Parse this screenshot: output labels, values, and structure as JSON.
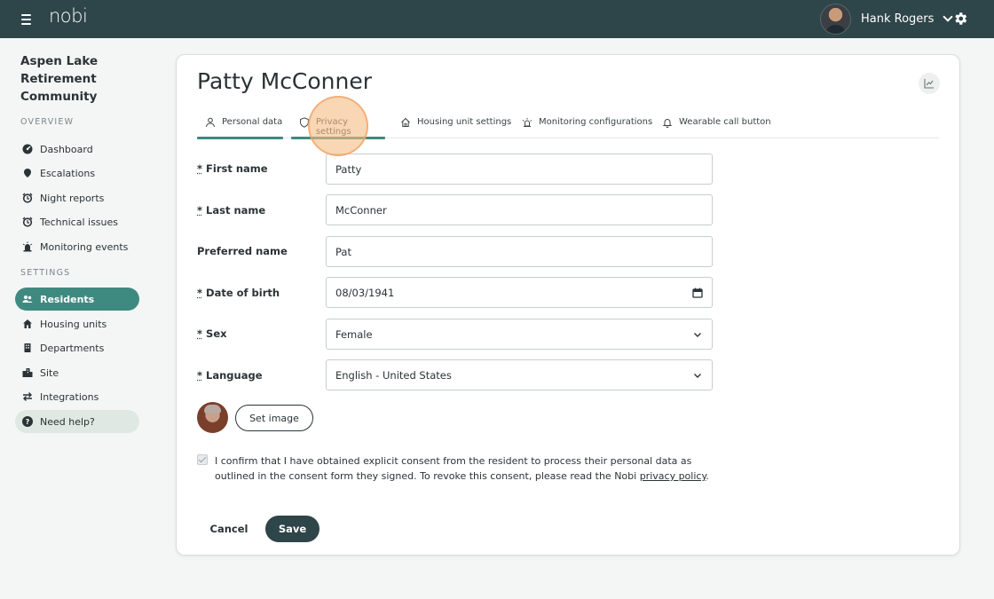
{
  "header": {
    "logo": "nobi",
    "user_name": "Hank Rogers"
  },
  "sidebar": {
    "community_name": "Aspen Lake Retirement Community",
    "overview_label": "OVERVIEW",
    "overview_items": [
      {
        "label": "Dashboard",
        "icon": "dashboard-icon"
      },
      {
        "label": "Escalations",
        "icon": "escalation-icon"
      },
      {
        "label": "Night reports",
        "icon": "alarm-clock-icon"
      },
      {
        "label": "Technical issues",
        "icon": "alarm-clock-icon"
      },
      {
        "label": "Monitoring events",
        "icon": "siren-icon"
      }
    ],
    "settings_label": "SETTINGS",
    "settings_items": [
      {
        "label": "Residents",
        "icon": "users-icon",
        "active": true
      },
      {
        "label": "Housing units",
        "icon": "home-icon"
      },
      {
        "label": "Departments",
        "icon": "building-icon"
      },
      {
        "label": "Site",
        "icon": "site-icon"
      },
      {
        "label": "Integrations",
        "icon": "swap-arrows-icon"
      }
    ],
    "help_label": "Need help?"
  },
  "page": {
    "title": "Patty McConner",
    "tabs": [
      {
        "label": "Personal data",
        "icon": "person-icon",
        "active": true
      },
      {
        "label": "Privacy settings",
        "icon": "shield-icon",
        "hover": true
      },
      {
        "label": "Housing unit settings",
        "icon": "house-icon"
      },
      {
        "label": "Monitoring configurations",
        "icon": "sensor-icon"
      },
      {
        "label": "Wearable call button",
        "icon": "bell-icon"
      }
    ],
    "form": {
      "required_mark": "*",
      "first_name_label": "First name",
      "first_name_value": "Patty",
      "last_name_label": "Last name",
      "last_name_value": "McConner",
      "preferred_name_label": "Preferred name",
      "preferred_name_value": "Pat",
      "dob_label": "Date of birth",
      "dob_value": "08/03/1941",
      "sex_label": "Sex",
      "sex_value": "Female",
      "language_label": "Language",
      "language_value": "English - United States",
      "set_image_label": "Set image",
      "consent_text": "I confirm that I have obtained explicit consent from the resident to process their personal data as outlined in the consent form they signed. To revoke this consent, please read the Nobi ",
      "consent_link": "privacy policy",
      "consent_end": ".",
      "consent_checked": true
    },
    "actions": {
      "cancel_label": "Cancel",
      "save_label": "Save"
    }
  },
  "colors": {
    "topbar": "#2e4549",
    "accent": "#3f8a80",
    "highlight": "#f5ba82"
  }
}
